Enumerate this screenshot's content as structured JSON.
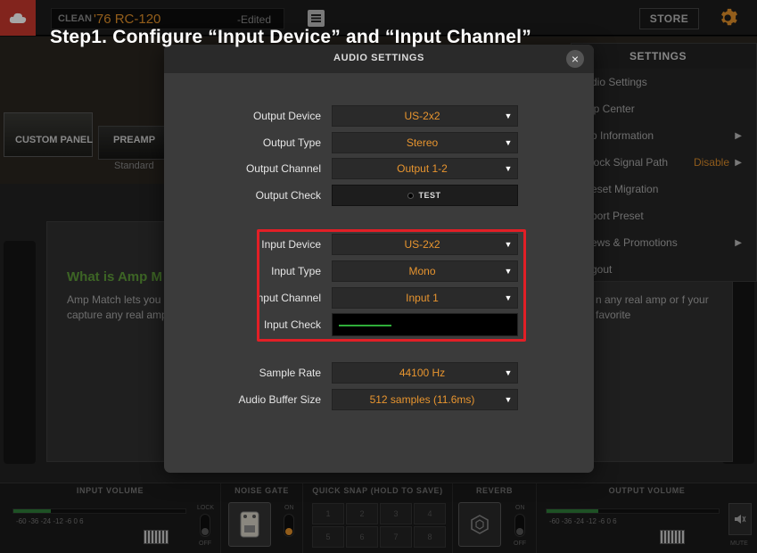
{
  "topbar": {
    "preset_category": "CLEAN",
    "preset_name": "'76 RC-120",
    "preset_status": "-Edited",
    "store_label": "STORE"
  },
  "step_title": "Step1.  Configure “Input Device” and “Input Channel”",
  "background": {
    "custom_panel_label": "CUSTOM PANEL",
    "preamp_label": "PREAMP",
    "preamp_mode": "Standard",
    "amp_match_title": "What is Amp M",
    "amp_match_text": "Amp Match lets you capture any real amp",
    "amp_match_text_right": "n any real amp or f your favorite"
  },
  "settings_menu": {
    "title": "SETTINGS",
    "items": [
      {
        "label": "dio Settings"
      },
      {
        "label": "lp Center"
      },
      {
        "label": "p Information",
        "chevron": "▶"
      },
      {
        "label": "lock Signal Path",
        "extra": "Disable",
        "chevron": "▶"
      },
      {
        "label": "eset Migration"
      },
      {
        "label": "port Preset"
      },
      {
        "label": "ews & Promotions",
        "chevron": "▶"
      },
      {
        "label": "gout"
      }
    ]
  },
  "dialog": {
    "title": "AUDIO SETTINGS",
    "close_glyph": "×",
    "output_device": {
      "label": "Output Device",
      "value": "US-2x2"
    },
    "output_type": {
      "label": "Output Type",
      "value": "Stereo"
    },
    "output_channel": {
      "label": "Output Channel",
      "value": "Output 1-2"
    },
    "output_check": {
      "label": "Output Check",
      "button": "TEST"
    },
    "input_device": {
      "label": "Input Device",
      "value": "US-2x2"
    },
    "input_type": {
      "label": "Input Type",
      "value": "Mono"
    },
    "input_channel": {
      "label": "nput Channel",
      "value": "Input 1"
    },
    "input_check": {
      "label": "Input Check",
      "level": 0.3
    },
    "sample_rate": {
      "label": "Sample Rate",
      "value": "44100 Hz"
    },
    "buffer_size": {
      "label": "Audio Buffer Size",
      "value": "512 samples (11.6ms)"
    },
    "dropdown_arrow": "▼",
    "highlight_color": "#e21f26"
  },
  "bottombar": {
    "input_volume": "INPUT VOLUME",
    "noise_gate": "NOISE GATE",
    "quick_snap": "QUICK SNAP (HOLD TO SAVE)",
    "reverb": "REVERB",
    "output_volume": "OUTPUT VOLUME",
    "ticks": "-60   -36  -24    -12     -6     0    6",
    "lock": "LOCK",
    "off": "OFF",
    "on": "ON",
    "mute": "MUTE",
    "snap_slots": [
      "1",
      "2",
      "3",
      "4",
      "5",
      "6",
      "7",
      "8"
    ],
    "input_meter_level": 0.22,
    "output_meter_level": 0.3
  },
  "colors": {
    "accent": "#e8952f",
    "logo": "#c8382d",
    "meter": "#2e7d3a"
  }
}
